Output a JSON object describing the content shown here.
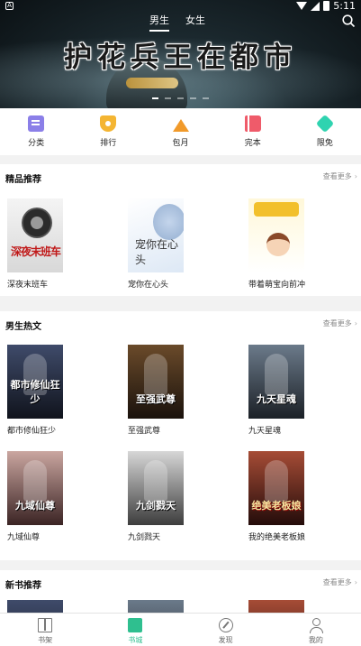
{
  "status_bar": {
    "time": "5:11"
  },
  "hero": {
    "title": "护花兵王在都市",
    "gender_tabs": [
      {
        "label": "男生",
        "active": true
      },
      {
        "label": "女生",
        "active": false
      }
    ],
    "slide_count": 5,
    "active_slide": 1
  },
  "categories": [
    {
      "label": "分类",
      "icon": "category-icon",
      "color": "#8b7fe8"
    },
    {
      "label": "排行",
      "icon": "ranking-icon",
      "color": "#f4b532"
    },
    {
      "label": "包月",
      "icon": "crown-icon",
      "color": "#f19a2a"
    },
    {
      "label": "完本",
      "icon": "book-icon",
      "color": "#ef5b6a"
    },
    {
      "label": "限免",
      "icon": "tag-icon",
      "color": "#2fd3b0"
    }
  ],
  "sections": {
    "featured": {
      "title": "精品推荐",
      "more": "查看更多",
      "books": [
        {
          "title": "深夜末班车",
          "cover_text": "深夜末班车"
        },
        {
          "title": "宠你在心头",
          "cover_text": "宠你在心头"
        },
        {
          "title": "带着萌宝向前冲",
          "cover_text": ""
        }
      ]
    },
    "male_hot": {
      "title": "男生热文",
      "more": "查看更多",
      "books": [
        {
          "title": "都市修仙狂少",
          "cover_text": "都市修仙狂少"
        },
        {
          "title": "至强武尊",
          "cover_text": "至强武尊"
        },
        {
          "title": "九天星魂",
          "cover_text": "九天星魂"
        },
        {
          "title": "九域仙尊",
          "cover_text": "九域仙尊"
        },
        {
          "title": "九剑戮天",
          "cover_text": "九剑戮天"
        },
        {
          "title": "我的绝美老板娘",
          "cover_text": "绝美老板娘"
        }
      ]
    },
    "new_books": {
      "title": "新书推荐",
      "more": "查看更多"
    }
  },
  "bottom_nav": [
    {
      "label": "书架",
      "active": false
    },
    {
      "label": "书城",
      "active": true
    },
    {
      "label": "发现",
      "active": false
    },
    {
      "label": "我的",
      "active": false
    }
  ],
  "accent_color": "#2fbf8f"
}
